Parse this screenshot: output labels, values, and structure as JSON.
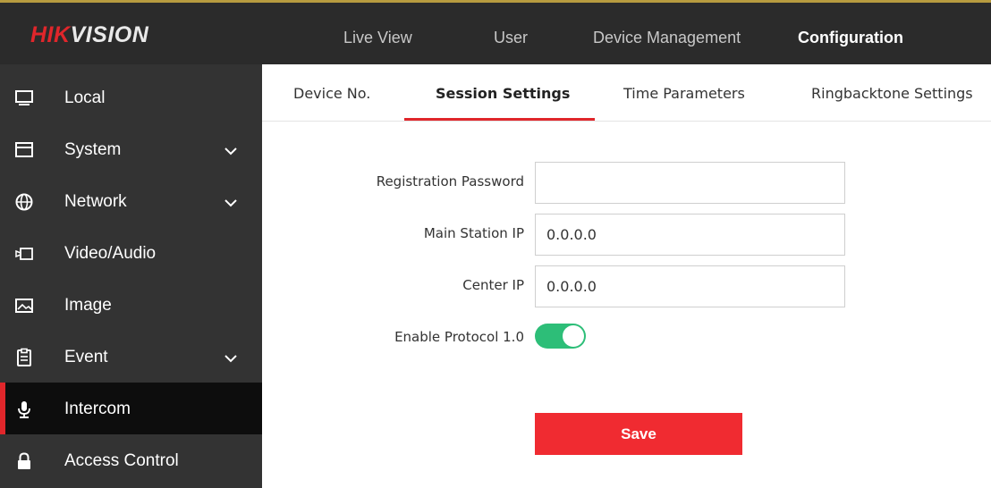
{
  "brand": {
    "logo_part1": "HIK",
    "logo_part2": "VISION"
  },
  "top_nav": [
    {
      "label": "Live View",
      "active": false
    },
    {
      "label": "User",
      "active": false
    },
    {
      "label": "Device Management",
      "active": false
    },
    {
      "label": "Configuration",
      "active": true
    }
  ],
  "sidebar": {
    "items": [
      {
        "label": "Local",
        "icon": "monitor-icon",
        "expandable": false,
        "active": false
      },
      {
        "label": "System",
        "icon": "window-icon",
        "expandable": true,
        "active": false
      },
      {
        "label": "Network",
        "icon": "globe-icon",
        "expandable": true,
        "active": false
      },
      {
        "label": "Video/Audio",
        "icon": "video-icon",
        "expandable": false,
        "active": false
      },
      {
        "label": "Image",
        "icon": "image-icon",
        "expandable": false,
        "active": false
      },
      {
        "label": "Event",
        "icon": "clipboard-icon",
        "expandable": true,
        "active": false
      },
      {
        "label": "Intercom",
        "icon": "microphone-icon",
        "expandable": false,
        "active": true
      },
      {
        "label": "Access Control",
        "icon": "lock-icon",
        "expandable": false,
        "active": false
      }
    ]
  },
  "tabs": [
    {
      "label": "Device No.",
      "active": false
    },
    {
      "label": "Session Settings",
      "active": true
    },
    {
      "label": "Time Parameters",
      "active": false
    },
    {
      "label": "Ringbacktone Settings",
      "active": false
    }
  ],
  "form": {
    "registration_password": {
      "label": "Registration Password",
      "value": ""
    },
    "main_station_ip": {
      "label": "Main Station IP",
      "value": "0.0.0.0"
    },
    "center_ip": {
      "label": "Center IP",
      "value": "0.0.0.0"
    },
    "enable_protocol": {
      "label": "Enable Protocol 1.0",
      "enabled": true
    },
    "save_label": "Save"
  },
  "colors": {
    "accent_red": "#e0262b",
    "save_button": "#f02b31",
    "toggle_on": "#2dbe78",
    "topbar_bg": "#2b2b2b",
    "sidebar_bg": "#333333",
    "sidebar_active_bg": "#0d0d0d"
  }
}
